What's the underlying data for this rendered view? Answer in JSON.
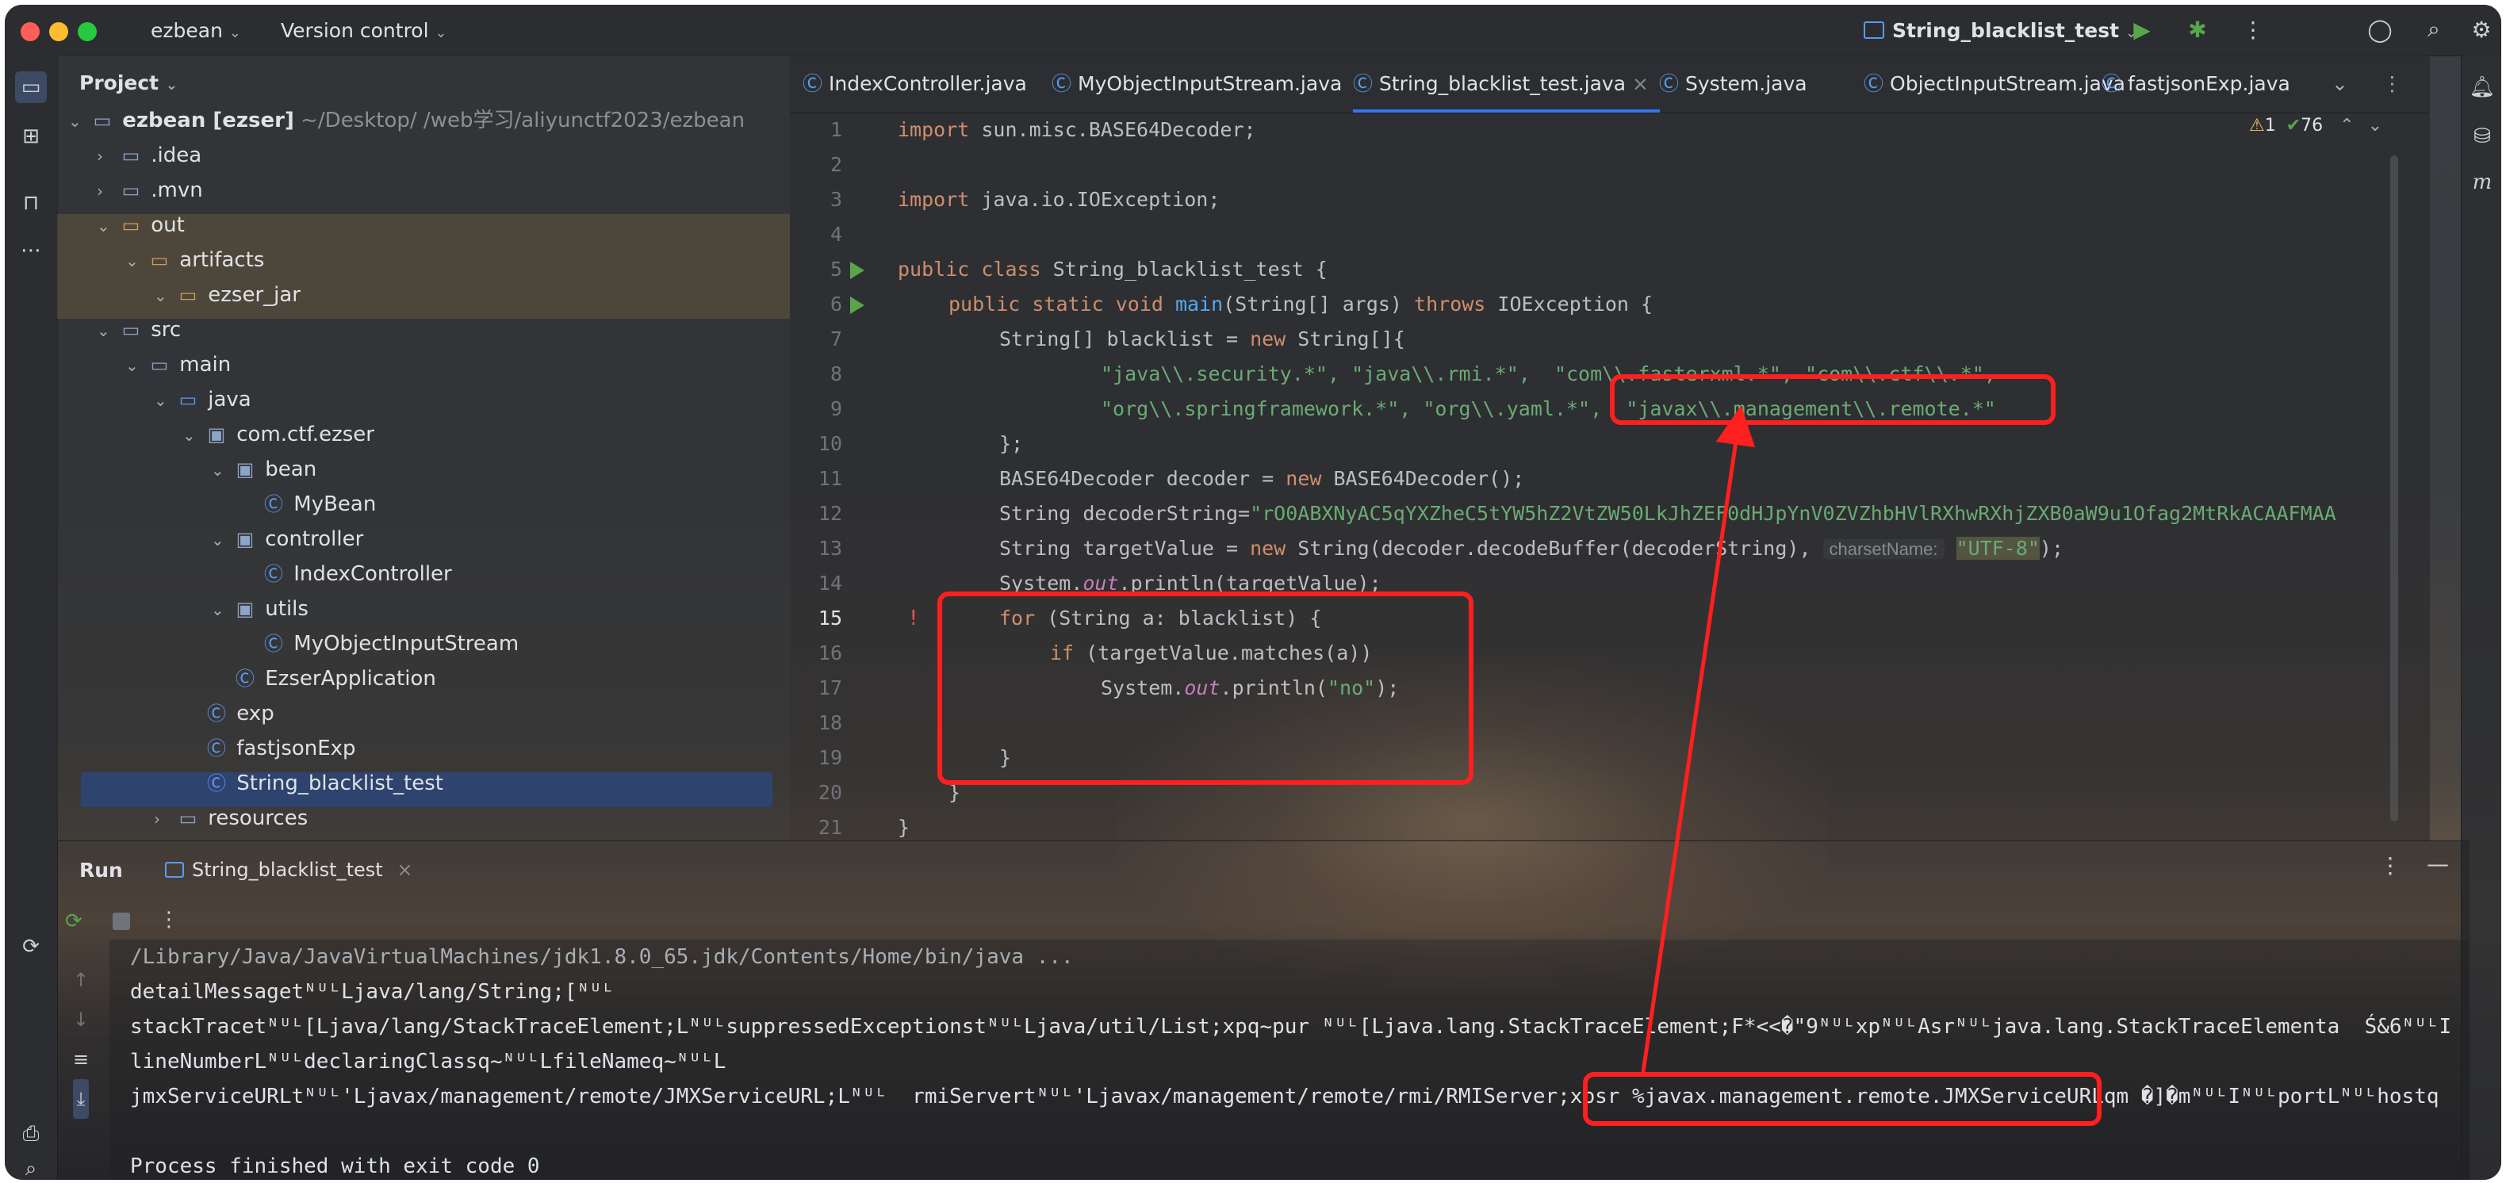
{
  "titlebar": {
    "project": "ezbean",
    "vcs": "Version control",
    "run_config": "String_blacklist_test",
    "colors": {
      "close": "#ff5f57",
      "min": "#febc2e",
      "max": "#28c840"
    }
  },
  "project_panel": {
    "title": "Project",
    "root_name": "ezbean [ezser]",
    "root_path": "~/Desktop/       /web学习/aliyunctf2023/ezbean",
    "items": [
      ".idea",
      ".mvn",
      "out",
      "artifacts",
      "ezser_jar",
      "src",
      "main",
      "java",
      "com.ctf.ezser",
      "bean",
      "MyBean",
      "controller",
      "IndexController",
      "utils",
      "MyObjectInputStream",
      "EzserApplication",
      "exp",
      "fastjsonExp",
      "String_blacklist_test",
      "resources"
    ]
  },
  "editor": {
    "tabs": [
      "IndexController.java",
      "MyObjectInputStream.java",
      "String_blacklist_test.java",
      "System.java",
      "ObjectInputStream.java",
      "fastjsonExp.java"
    ],
    "warnings": "1",
    "checks": "76",
    "line_numbers": [
      "1",
      "2",
      "3",
      "4",
      "5",
      "6",
      "7",
      "8",
      "9",
      "10",
      "11",
      "12",
      "13",
      "14",
      "15",
      "16",
      "17",
      "18",
      "19",
      "20",
      "21"
    ],
    "code": {
      "l1a": "import",
      "l1b": " sun.misc.BASE64Decoder;",
      "l3a": "import",
      "l3b": " java.io.IOException;",
      "l5a": "public class",
      "l5b": " String_blacklist_test {",
      "l6a": "public static void",
      "l6b": "main",
      "l6c": "(String[] args) ",
      "l6d": "throws",
      "l6e": " IOException {",
      "l7a": "String[] blacklist = ",
      "l7b": "new",
      "l7c": " String[]{",
      "l8": "\"java\\\\.security.*\", \"java\\\\.rmi.*\",  \"com\\\\.fasterxml.*\", \"com\\\\.ctf\\\\.*\",",
      "l9a": "\"org\\\\.springframework.*\", \"org\\\\.yaml.*\",",
      "l9b": "\"javax\\\\.management\\\\.remote.*\"",
      "l10": "};",
      "l11a": "BASE64Decoder decoder = ",
      "l11b": "new",
      "l11c": " BASE64Decoder();",
      "l12a": "String decoderString=",
      "l12b": "\"rO0ABXNyAC5qYXZheC5tYW5hZ2VtZW50LkJhZEF0dHJpYnV0ZVZhbHVlRXhwRXhjZXB0aW9u1Ofag2MtRkACAAFMAA",
      "l13a": "String targetValue = ",
      "l13b": "new",
      "l13c": " String(decoder.decodeBuffer(decoderString), ",
      "l13hint": "charsetName:",
      "l13d": "\"UTF-8\"",
      "l13e": ");",
      "l14a": "System.",
      "l14b": "out",
      "l14c": ".println(targetValue);",
      "l15a": "for",
      "l15b": " (String a: blacklist) {",
      "l16a": "if",
      "l16b": " (targetValue.matches(a))",
      "l17a": "System.",
      "l17b": "out",
      "l17c": ".println(",
      "l17d": "\"no\"",
      "l17e": ");",
      "l19": "}",
      "l20": "}",
      "l21": "}"
    }
  },
  "run_panel": {
    "title": "Run",
    "tab": "String_blacklist_test",
    "console": [
      "/Library/Java/JavaVirtualMachines/jdk1.8.0_65.jdk/Contents/Home/bin/java ...",
      "detailMessagetᴺᵁᴸLjava/lang/String;[ᴺᵁᴸ",
      "stackTracetᴺᵁᴸ[Ljava/lang/StackTraceElement;LᴺᵁᴸsuppressedExceptionstᴺᵁᴸLjava/util/List;xpq~pur ᴺᵁᴸ[Ljava.lang.StackTraceElement;F*<<�\"9ᴺᵁᴸxpᴺᵁᴸAsrᴺᵁᴸjava.lang.StackTraceElementa  Ś&6ᴺᵁᴸI",
      "lineNumberLᴺᵁᴸdeclaringClassq~ᴺᵁᴸLfileNameq~ᴺᵁᴸL",
      "jmxServiceURLtᴺᵁᴸ'Ljavax/management/remote/JMXServiceURL;Lᴺᵁᴸ  rmiServertᴺᵁᴸ'Ljavax/management/remote/rmi/RMIServer;xpsr %javax.management.remote.JMXServiceURLqm �]�mᴺᵁᴸIᴺᵁᴸportLᴺᵁᴸhostq",
      "Process finished with exit code 0"
    ]
  }
}
